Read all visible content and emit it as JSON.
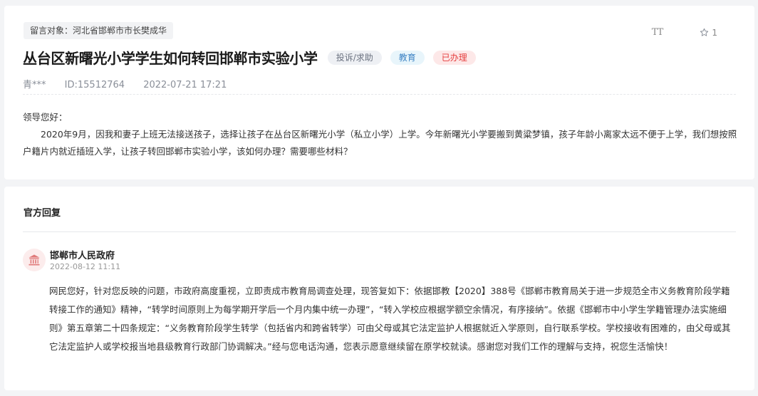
{
  "message": {
    "target_label": "留言对象：河北省邯郸市市长樊成华",
    "title": "丛台区新曙光小学学生如何转回邯郸市实验小学",
    "badges": {
      "type": "投诉/求助",
      "category": "教育",
      "status": "已办理"
    },
    "font_size_label": "TT",
    "favorite_count": "1",
    "author": "青***",
    "id_label": "ID:15512764",
    "datetime": "2022-07-21 17:21",
    "greeting": "领导您好：",
    "body": "2020年9月，因我和妻子上班无法接送孩子，选择让孩子在丛台区新曙光小学（私立小学）上学。今年新曙光小学要搬到黄粱梦镇，孩子年龄小离家太远不便于上学，我们想按照户籍片内就近插班入学，让孩子转回邯郸市实验小学，该如何办理？需要哪些材料？"
  },
  "official_reply": {
    "section_title": "官方回复",
    "org_name": "邯郸市人民政府",
    "date": "2022-08-12 11:11",
    "body": "网民您好，针对您反映的问题，市政府高度重视，立即责成市教育局调查处理，现答复如下：依据邯教【2020】388号《邯郸市教育局关于进一步规范全市义务教育阶段学籍转接工作的通知》精神，“转学时间原则上为每学期开学后一个月内集中统一办理”，“转入学校应根据学额空余情况，有序接纳”。依据《邯郸市中小学生学籍管理办法实施细则》第五章第二十四条规定：“义务教育阶段学生转学（包括省内和跨省转学）可由父母或其它法定监护人根据就近入学原则，自行联系学校。学校接收有困难的，由父母或其它法定监护人或学校报当地县级教育行政部门协调解决。”经与您电话沟通，您表示愿意继续留在原学校就读。感谢您对我们工作的理解与支持，祝您生活愉快！"
  },
  "colors": {
    "status_red": "#e53e3e",
    "category_blue": "#3b82c4",
    "gov_icon_red": "#d9534f"
  },
  "icons": {
    "font_size": "font-size-icon",
    "favorite": "star-outline-icon",
    "org_avatar": "government-building-icon"
  }
}
